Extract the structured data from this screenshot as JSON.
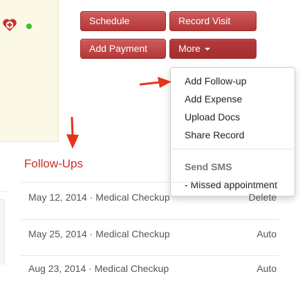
{
  "toolbar": {
    "schedule_label": "Schedule",
    "record_visit_label": "Record Visit",
    "add_payment_label": "Add Payment",
    "more_label": "More"
  },
  "dropdown": {
    "items": [
      "Add Follow-up",
      "Add Expense",
      "Upload Docs",
      "Share Record"
    ],
    "sms_header": "Send SMS",
    "sms_items": [
      "- Missed appointment"
    ]
  },
  "followups": {
    "title": "Follow-Ups",
    "rows": [
      {
        "text": "May 12, 2014 · Medical Checkup",
        "action": "Delete"
      },
      {
        "text": "May 25, 2014 · Medical Checkup",
        "action": "Auto"
      },
      {
        "text": "Aug 23, 2014 · Medical Checkup",
        "action": "Auto"
      }
    ]
  },
  "icons": {
    "badge": "heart-badge-icon",
    "status": "online-status-dot",
    "arrows": [
      "annotation-arrow-right",
      "annotation-arrow-down"
    ]
  },
  "colors": {
    "button": "#b94a48",
    "section_title": "#c9302c",
    "arrow": "#e8321a",
    "card_bg": "#fbf8e6",
    "status_online": "#3fbf2f"
  }
}
